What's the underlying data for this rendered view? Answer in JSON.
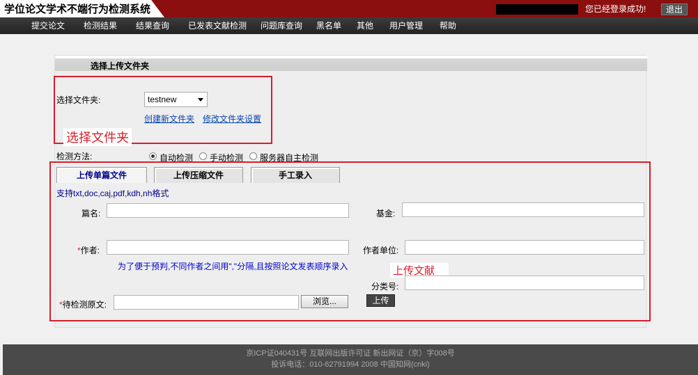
{
  "header": {
    "title": "学位论文学术不端行为检测系统",
    "login_msg": "您已经登录成功!",
    "logout_label": "退出"
  },
  "nav": {
    "items": [
      "提交论文",
      "检测结果",
      "结果查询",
      "已发表文献检测",
      "问题库查询",
      "黑名单",
      "其他",
      "用户管理",
      "帮助"
    ]
  },
  "panel": {
    "title": "选择上传文件夹",
    "folder_label": "选择文件夹:",
    "folder_value": "testnew",
    "create_folder": "创建新文件夹",
    "modify_folder": "修改文件夹设置",
    "annotation_folder": "选择文件夹",
    "method_label": "检测方法:",
    "methods": [
      "自动检测",
      "手动检测",
      "服务器自主检测"
    ],
    "selected_method": 0
  },
  "upload": {
    "tabs": [
      "上传单篇文件",
      "上传压缩文件",
      "手工录入"
    ],
    "active_tab": 0,
    "formats": "支持txt,doc,caj,pdf,kdh,nh格式",
    "title_label": "篇名:",
    "fund_label": "基金:",
    "author_label": "作者:",
    "affiliation_label": "作者单位:",
    "author_hint": "为了便于预判,不同作者之间用\",\"分隔,且按照论文发表顺序录入",
    "annotation_upload": "上传文献",
    "class_label": "分类号:",
    "file_label": "待检测原文:",
    "browse_label": "浏览...",
    "upload_label": "上传",
    "required_mark": "*"
  },
  "footer": {
    "line1": "京ICP证040431号  互联网出版许可证  新出网证（京）字008号",
    "line2": "投诉电话：010-62791994 2008 中国知网(cnki)"
  },
  "colors": {
    "header_bg": "#8b0f0f",
    "annotation_red": "#d81e2a",
    "tab_active": "#00008b"
  }
}
